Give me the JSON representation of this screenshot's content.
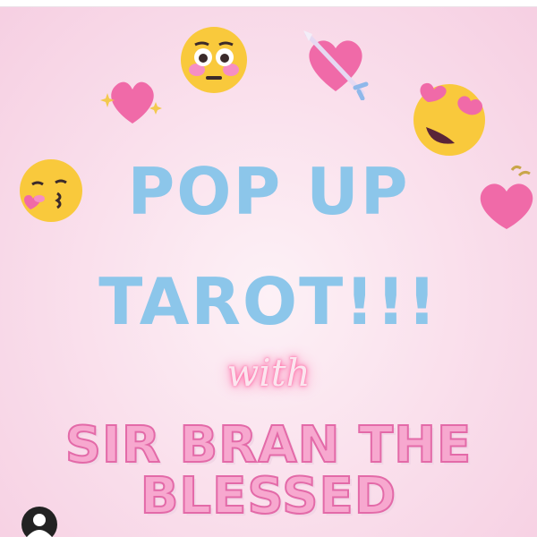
{
  "poster": {
    "line1": "POP UP",
    "line2": "TAROT!!!",
    "with": "with",
    "name_line1": "SIR BRAN THE",
    "name_line2": "BLESSED"
  },
  "colors": {
    "background": "#f9dcea",
    "headline": "#8cc6ea",
    "name_fill": "#f7a8cf",
    "name_stroke": "#e36aa8",
    "neon_glow": "#ff6fa8"
  },
  "emojis": [
    "flushed-face-icon",
    "heart-with-arrow-icon",
    "sparkling-heart-icon",
    "smiling-face-with-heart-eyes-icon",
    "kissing-face-icon",
    "beating-heart-icon"
  ],
  "profile": {
    "icon": "user-avatar-icon"
  }
}
